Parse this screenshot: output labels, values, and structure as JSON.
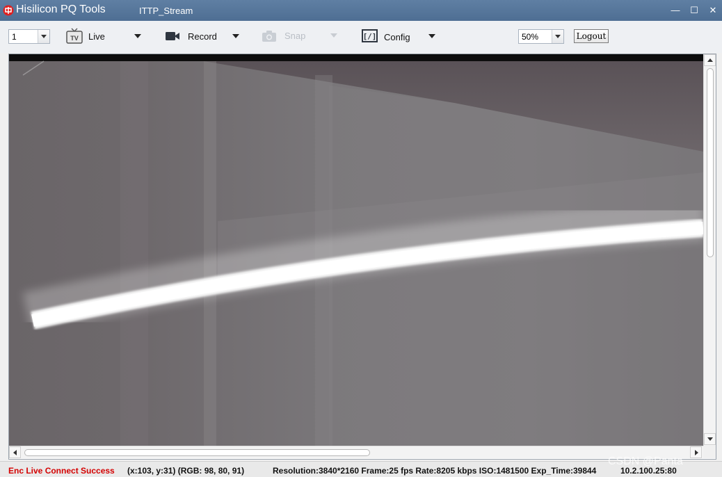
{
  "window": {
    "app_title": "Hisilicon PQ Tools",
    "stream_title": "ITTP_Stream",
    "minimize": "—",
    "maximize": "☐",
    "close": "✕"
  },
  "toolbar": {
    "channel_value": "1",
    "live_label": "Live",
    "record_label": "Record",
    "snap_label": "Snap",
    "config_label": "Config",
    "zoom_value": "50%",
    "logout_label": "Logout",
    "icons": {
      "live": "tv-icon",
      "record": "video-camera-icon",
      "snap": "camera-icon",
      "config": "config-bracket-icon"
    }
  },
  "status": {
    "connection": "Enc Live Connect Success",
    "pixel": "(x:103, y:31) (RGB: 98, 80, 91)",
    "stream_info": "Resolution:3840*2160  Frame:25 fps  Rate:8205 kbps ISO:1481500 Exp_Time:39844",
    "ip": "10.2.100.25:80",
    "connection_color": "#d40000"
  },
  "watermark": "CSDN @Panta"
}
